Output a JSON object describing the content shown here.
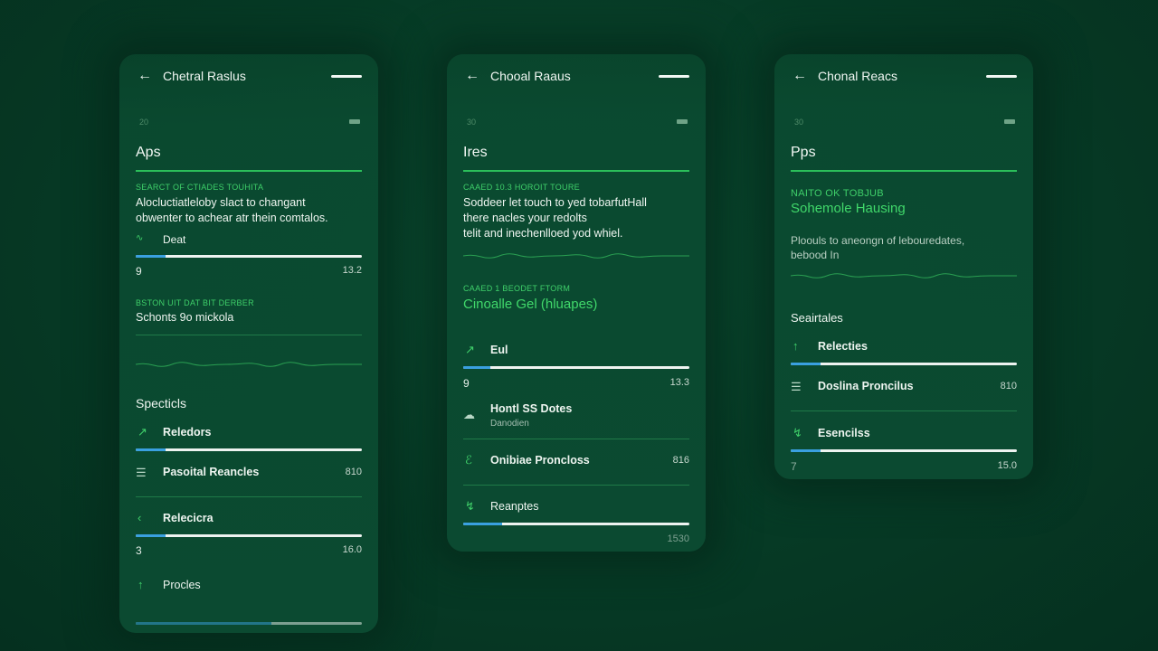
{
  "screens": [
    {
      "title": "Chetral Raslus",
      "status_time": "20",
      "heading": "Aps",
      "caption1": "SEARCT OF CTIADES TOUHITA",
      "desc1": "Alocluctiatleloby slact to changant",
      "desc2": "obwenter to achear atr thein comtalos.",
      "slider1": {
        "label": "Deat",
        "min": "9",
        "max": "13.2",
        "progress": 0.13
      },
      "caption2": "BSTON UIT DAT BIT DERBER",
      "line2": "Schonts 9o mickola",
      "section": "Specticls",
      "items": [
        {
          "label": "Reledors",
          "icon": "arrow-up-right-icon",
          "progress": 0.13
        },
        {
          "label": "Pasoital Reancles",
          "icon": "stack-icon",
          "value": "810"
        },
        {
          "label": "Relecicra",
          "icon": "chevron-left-icon",
          "min": "3",
          "max": "16.0",
          "progress": 0.13
        },
        {
          "label": "Procles",
          "icon": "arrow-up-icon"
        }
      ]
    },
    {
      "title": "Chooal Raaus",
      "status_time": "30",
      "heading": "Ires",
      "caption1": "CAAED 10.3 HOROIT TOURE",
      "desc1": "Soddeer let touch to yed tobarfutHall",
      "desc2": "there nacles your redolts",
      "desc3": "telit and inechenlloed yod whiel.",
      "caption2": "CAAED 1 BEODET FTORM",
      "green_line": "Cinoalle Gel (hluapes)",
      "slider1": {
        "label": "Eul",
        "icon": "arrow-up-right-icon",
        "min": "9",
        "max": "13.3",
        "progress": 0.12
      },
      "items": [
        {
          "label": "Hontl SS Dotes",
          "sub": "Danodien",
          "icon": "cloud-icon"
        },
        {
          "label": "Onibiae Proncloss",
          "icon": "leaf-icon",
          "value": "816"
        },
        {
          "label": "Reanptes",
          "icon": "bolt-icon",
          "max": "1530",
          "progress": 0.17
        }
      ]
    },
    {
      "title": "Chonal Reacs",
      "status_time": "30",
      "heading": "Pps",
      "caption1": "NAITO OK TOBJUB",
      "green_line": "Sohemole Hausing",
      "desc1": "Ploouls to aneongn of lebouredates,",
      "desc2": "bebood In",
      "section": "Seairtales",
      "items": [
        {
          "label": "Relecties",
          "icon": "arrow-up-icon",
          "progress": 0.13
        },
        {
          "label": "Doslina Proncilus",
          "icon": "stack-icon",
          "value": "810"
        },
        {
          "label": "Esencilss",
          "icon": "bolt-icon",
          "min": "7",
          "max": "15.0",
          "progress": 0.13
        }
      ]
    }
  ],
  "colors": {
    "accent": "#2bbf5a",
    "progress": "#3aa0e0",
    "bg": "#063a25"
  }
}
